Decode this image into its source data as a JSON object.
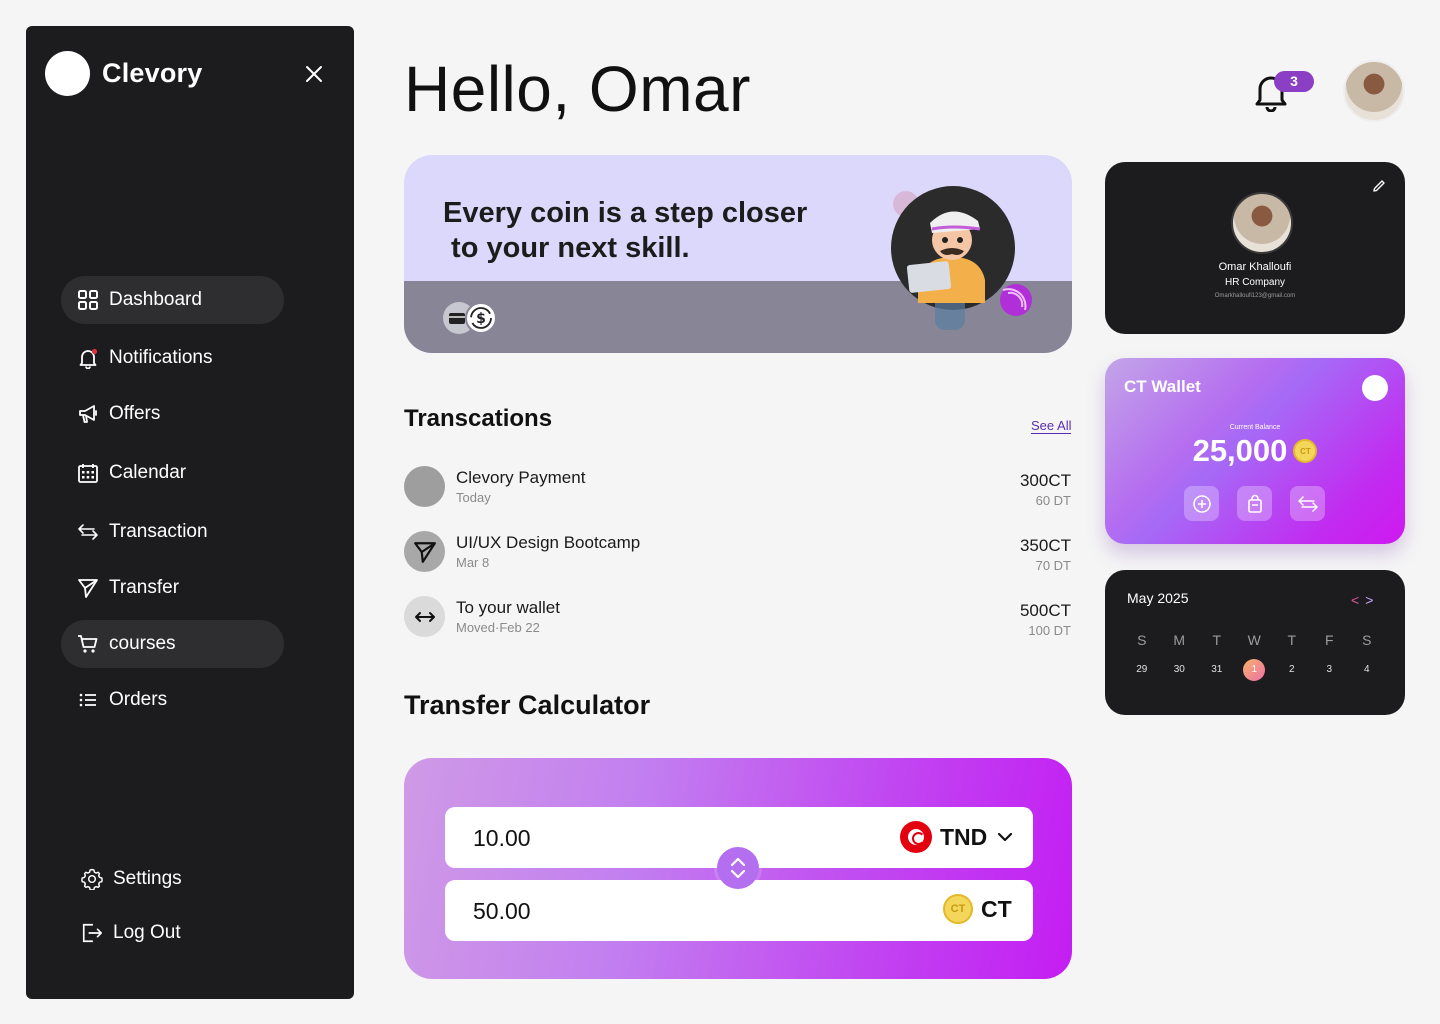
{
  "app": {
    "name": "Clevory"
  },
  "sidebar": {
    "items": [
      {
        "label": "Dashboard",
        "icon": "dashboard-icon",
        "active": true
      },
      {
        "label": "Notifications",
        "icon": "bell-icon",
        "active": false
      },
      {
        "label": "Offers",
        "icon": "megaphone-icon",
        "active": false
      },
      {
        "label": "Calendar",
        "icon": "calendar-icon",
        "active": false
      },
      {
        "label": "Transaction",
        "icon": "arrows-icon",
        "active": false
      },
      {
        "label": "Transfer",
        "icon": "send-icon",
        "active": false
      },
      {
        "label": "courses",
        "icon": "cart-icon",
        "active": true
      },
      {
        "label": "Orders",
        "icon": "list-icon",
        "active": false
      }
    ],
    "bottom": [
      {
        "label": "Settings",
        "icon": "gear-icon"
      },
      {
        "label": "Log Out",
        "icon": "logout-icon"
      }
    ]
  },
  "header": {
    "greeting": "Hello, Omar",
    "notification_count": "3"
  },
  "banner": {
    "text": "Every coin is a step closer\n to your next skill."
  },
  "transactions": {
    "title": "Transcations",
    "see_all": "See All",
    "items": [
      {
        "title": "Clevory Payment",
        "sub": "Today",
        "amount": "300CT",
        "dt": "60 DT",
        "icon": "coin-placeholder-icon"
      },
      {
        "title": "UI/UX Design Bootcamp",
        "sub": "Mar 8",
        "amount": "350CT",
        "dt": "70 DT",
        "icon": "send-icon"
      },
      {
        "title": "To your wallet",
        "sub": "Moved·Feb 22",
        "amount": "500CT",
        "dt": "100 DT",
        "icon": "arrows-horizontal-icon"
      }
    ]
  },
  "calculator": {
    "title": "Transfer Calculator",
    "from_value": "10.00",
    "from_currency": "TND",
    "to_value": "50.00",
    "to_currency": "CT",
    "coin_label": "CT"
  },
  "profile": {
    "name": "Omar Khalloufi",
    "company": "HR Company",
    "email": "Omarkhalloufi123@gmail.com"
  },
  "wallet": {
    "title": "CT Wallet",
    "caption": "Current Balance",
    "balance": "25,000",
    "coin_label": "CT"
  },
  "calendar": {
    "month": "May 2025",
    "prev": "<",
    "next": ">",
    "weekdays": [
      "S",
      "M",
      "T",
      "W",
      "T",
      "F",
      "S"
    ],
    "days": [
      "29",
      "30",
      "31",
      "1",
      "2",
      "3",
      "4"
    ],
    "today_index": 3
  },
  "colors": {
    "sidebar_bg": "#1c1c1e",
    "accent": "#8a3fc4",
    "wallet_gradient_end": "#d018f0",
    "banner_bg": "#dcd8fb"
  }
}
